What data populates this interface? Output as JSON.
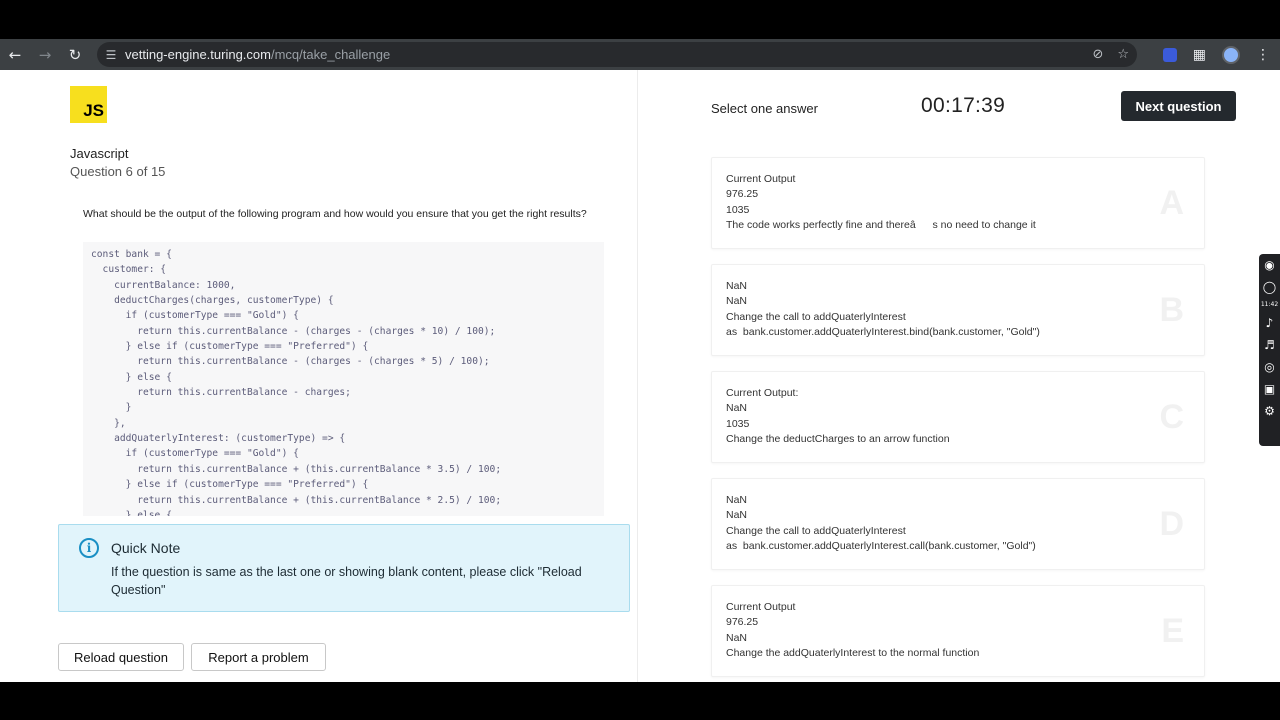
{
  "browser": {
    "url_domain": "vetting-engine.turing.com",
    "url_path": "/mcq/take_challenge"
  },
  "question": {
    "logo_text": "JS",
    "language": "Javascript",
    "number_text": "Question 6 of 15",
    "text": "What should be the output of the following program and how would you ensure that you get the right results?",
    "code_lines": [
      "const bank = {",
      "  customer: {",
      "    currentBalance: 1000,",
      "    deductCharges(charges, customerType) {",
      "      if (customerType === \"Gold\") {",
      "        return this.currentBalance - (charges - (charges * 10) / 100);",
      "      } else if (customerType === \"Preferred\") {",
      "        return this.currentBalance - (charges - (charges * 5) / 100);",
      "      } else {",
      "        return this.currentBalance - charges;",
      "      }",
      "    },",
      "    addQuaterlyInterest: (customerType) => {",
      "      if (customerType === \"Gold\") {",
      "        return this.currentBalance + (this.currentBalance * 3.5) / 100;",
      "      } else if (customerType === \"Preferred\") {",
      "        return this.currentBalance + (this.currentBalance * 2.5) / 100;",
      "      } else {"
    ]
  },
  "quick_note": {
    "icon": "info-icon",
    "title": "Quick Note",
    "body": "If the question is same as the last one or showing blank content, please click \"Reload Question\""
  },
  "buttons": {
    "reload": "Reload question",
    "report": "Report a problem",
    "next": "Next question"
  },
  "header": {
    "select_label": "Select one answer",
    "timer": "00:17:39"
  },
  "options": [
    {
      "letter": "A",
      "lines": [
        "Current Output",
        "976.25",
        "1035",
        "The code works perfectly fine and thereâs no need to change it"
      ]
    },
    {
      "letter": "B",
      "lines": [
        "NaN",
        "NaN",
        "Change the call to addQuaterlyInterest",
        "as  bank.customer.addQuaterlyInterest.bind(bank.customer, \"Gold\")"
      ]
    },
    {
      "letter": "C",
      "lines": [
        "Current Output:",
        "NaN",
        "1035",
        "Change the deductCharges to an arrow function"
      ]
    },
    {
      "letter": "D",
      "lines": [
        "NaN",
        "NaN",
        "Change the call to addQuaterlyInterest",
        "as  bank.customer.addQuaterlyInterest.call(bank.customer, \"Gold\")"
      ]
    },
    {
      "letter": "E",
      "lines": [
        "Current Output",
        "976.25",
        "NaN",
        "Change the addQuaterlyInterest to the normal function"
      ]
    }
  ],
  "side_toolbar": {
    "clock": "11:42"
  }
}
